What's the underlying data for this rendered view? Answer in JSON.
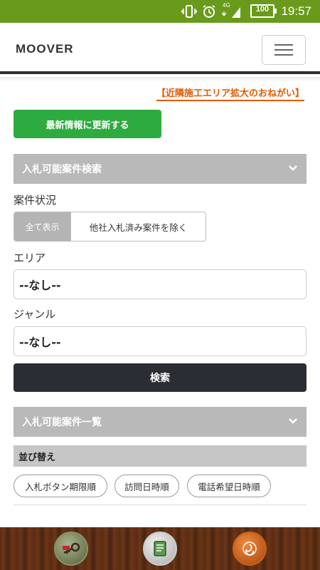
{
  "status_bar": {
    "time": "19:57",
    "battery": "100",
    "network": "4G"
  },
  "header": {
    "logo": "MOOVER"
  },
  "notice": {
    "link_text": "【近隣施工エリア拡大のおねがい】"
  },
  "buttons": {
    "update": "最新情報に更新する",
    "search": "検索"
  },
  "search_section": {
    "title": "入札可能案件検索",
    "status_label": "案件状況",
    "status_options": [
      "全て表示",
      "他社入札済み案件を除く"
    ],
    "area_label": "エリア",
    "area_value": "--なし--",
    "genre_label": "ジャンル",
    "genre_value": "--なし--"
  },
  "list_section": {
    "title": "入札可能案件一覧",
    "sort_label": "並び替え",
    "sort_options": [
      "入札ボタン期限順",
      "訪問日時順",
      "電話希望日時順"
    ]
  },
  "colors": {
    "status_bar": "#6a9a1b",
    "update_button": "#2eab3f",
    "search_button": "#2a2d33",
    "accent_orange": "#e05a00",
    "section_header": "#b9b9b9"
  },
  "bottom_nav": {
    "icons": [
      "key-cap-icon",
      "document-cap-icon",
      "triskele-cap-icon"
    ]
  }
}
